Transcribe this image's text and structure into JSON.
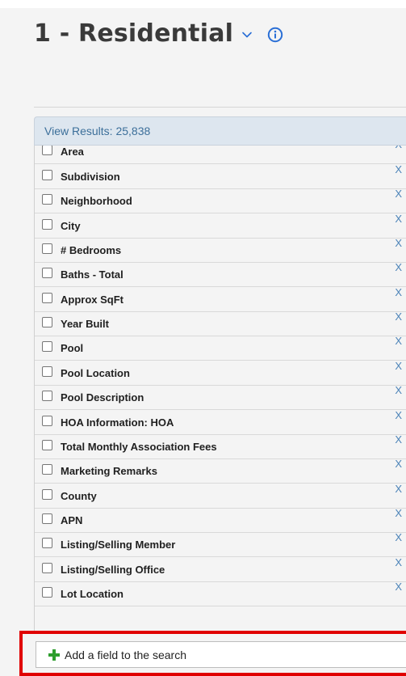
{
  "header": {
    "title": "1 - Residential"
  },
  "results": {
    "label": "View Results: 25,838"
  },
  "fields": [
    {
      "label": "Area",
      "remove": "X"
    },
    {
      "label": "Subdivision",
      "remove": "X"
    },
    {
      "label": "Neighborhood",
      "remove": "X"
    },
    {
      "label": "City",
      "remove": "X"
    },
    {
      "label": "# Bedrooms",
      "remove": "X"
    },
    {
      "label": "Baths - Total",
      "remove": "X"
    },
    {
      "label": "Approx SqFt",
      "remove": "X"
    },
    {
      "label": "Year Built",
      "remove": "X"
    },
    {
      "label": "Pool",
      "remove": "X"
    },
    {
      "label": "Pool Location",
      "remove": "X"
    },
    {
      "label": "Pool Description",
      "remove": "X"
    },
    {
      "label": "HOA Information: HOA",
      "remove": "X"
    },
    {
      "label": "Total Monthly Association Fees",
      "remove": "X"
    },
    {
      "label": "Marketing Remarks",
      "remove": "X"
    },
    {
      "label": "County",
      "remove": "X"
    },
    {
      "label": "APN",
      "remove": "X"
    },
    {
      "label": "Listing/Selling Member",
      "remove": "X"
    },
    {
      "label": "Listing/Selling Office",
      "remove": "X"
    },
    {
      "label": "Lot Location",
      "remove": "X"
    }
  ],
  "add_field": {
    "label": "Add a field to the search"
  },
  "icons": {
    "chevron": "chevron-down-icon",
    "info": "info-icon",
    "plus": "plus-icon"
  },
  "colors": {
    "title": "#3a3a3a",
    "accent_blue": "#2a6fd6",
    "results_bar": "#dde6ef",
    "results_text": "#3c6f9a",
    "remove_x": "#4d84b8",
    "plus_green": "#2e9e2e",
    "highlight_red": "#e00000"
  }
}
